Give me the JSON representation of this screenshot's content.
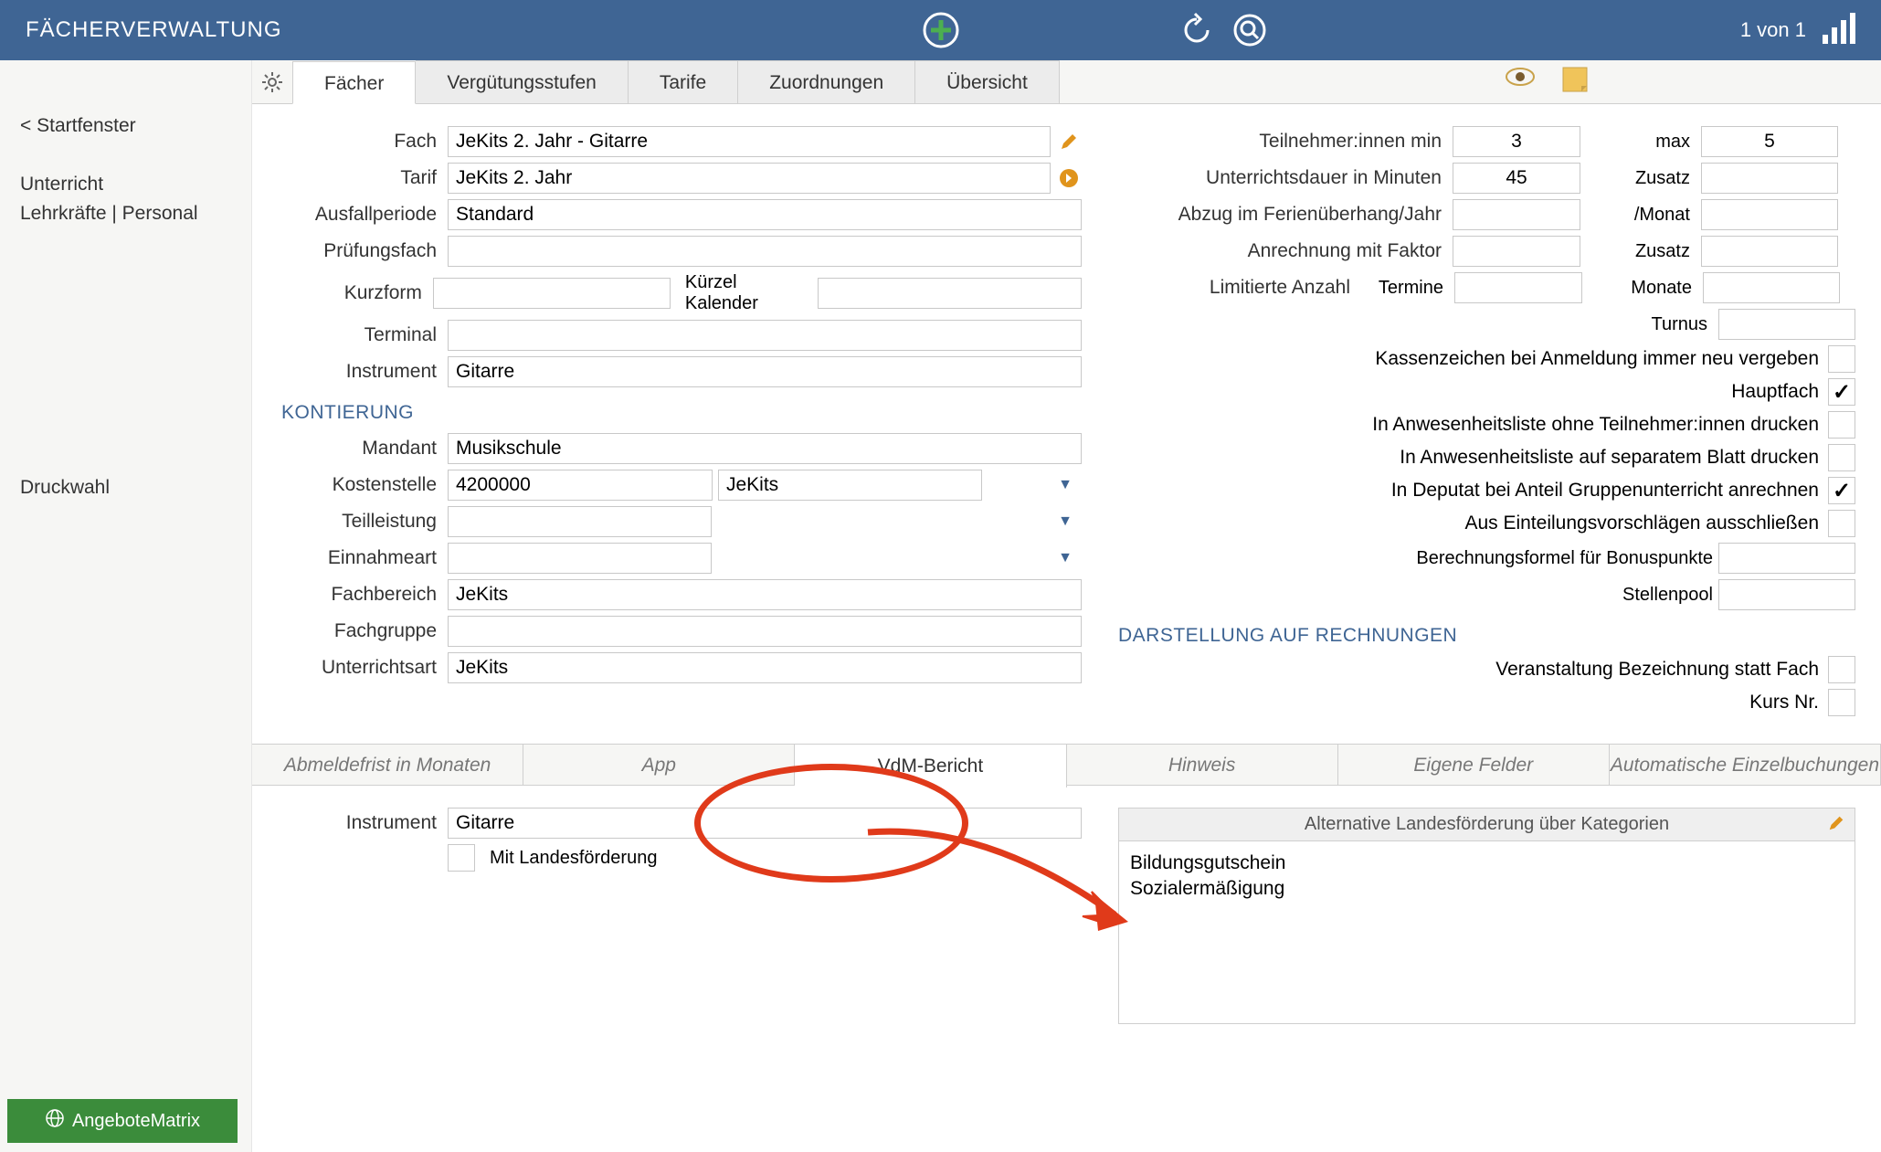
{
  "header": {
    "title": "FÄCHERVERWALTUNG",
    "counter": "1 von 1"
  },
  "sidebar": {
    "back": "< Startfenster",
    "unterricht": "Unterricht",
    "lehrkraefte": "Lehrkräfte | Personal",
    "druckwahl": "Druckwahl",
    "angebote": "AngeboteMatrix"
  },
  "tabs": {
    "t1": "Fächer",
    "t2": "Vergütungsstufen",
    "t3": "Tarife",
    "t4": "Zuordnungen",
    "t5": "Übersicht"
  },
  "left": {
    "fach_lbl": "Fach",
    "fach": "JeKits 2. Jahr - Gitarre",
    "tarif_lbl": "Tarif",
    "tarif": "JeKits 2. Jahr",
    "ausfall_lbl": "Ausfallperiode",
    "ausfall": "Standard",
    "pruef_lbl": "Prüfungsfach",
    "pruef": "",
    "kurz_lbl": "Kurzform",
    "kurz": "",
    "kuerzel_lbl": "Kürzel Kalender",
    "kuerzel": "",
    "terminal_lbl": "Terminal",
    "terminal": "",
    "instrument_lbl": "Instrument",
    "instrument": "Gitarre",
    "kontierung_title": "KONTIERUNG",
    "mandant_lbl": "Mandant",
    "mandant": "Musikschule",
    "kosten_lbl": "Kostenstelle",
    "kosten_num": "4200000",
    "kosten_name": "JeKits",
    "teill_lbl": "Teilleistung",
    "teill": "",
    "einnahme_lbl": "Einnahmeart",
    "einnahme": "",
    "fachbereich_lbl": "Fachbereich",
    "fachbereich": "JeKits",
    "fachgruppe_lbl": "Fachgruppe",
    "fachgruppe": "",
    "unterrichtsart_lbl": "Unterrichtsart",
    "unterrichtsart": "JeKits"
  },
  "right": {
    "teiln_lbl": "Teilnehmer:innen min",
    "teiln_min": "3",
    "max_lbl": "max",
    "teiln_max": "5",
    "dauer_lbl": "Unterrichtsdauer in Minuten",
    "dauer": "45",
    "zusatz_lbl": "Zusatz",
    "zusatz": "",
    "abzug_lbl": "Abzug im Ferienüberhang/Jahr",
    "abzug": "",
    "monat_lbl": "/Monat",
    "monat": "",
    "anrech_lbl": "Anrechnung mit Faktor",
    "anrech": "",
    "zusatz2_lbl": "Zusatz",
    "zusatz2": "",
    "limit_lbl": "Limitierte Anzahl",
    "termine_lbl": "Termine",
    "termine": "",
    "monate_lbl": "Monate",
    "monate": "",
    "turnus_lbl": "Turnus",
    "turnus": "",
    "cb1": "Kassenzeichen bei Anmeldung immer neu vergeben",
    "cb2": "Hauptfach",
    "cb3": "In Anwesenheitsliste ohne Teilnehmer:innen drucken",
    "cb4": "In Anwesenheitsliste auf separatem Blatt drucken",
    "cb5": "In Deputat bei Anteil Gruppenunterricht anrechnen",
    "cb6": "Aus Einteilungsvorschlägen ausschließen",
    "bonus_lbl": "Berechnungsformel für Bonuspunkte",
    "bonus": "",
    "pool_lbl": "Stellenpool",
    "pool": "",
    "darst_title": "DARSTELLUNG AUF RECHNUNGEN",
    "cb7": "Veranstaltung Bezeichnung statt Fach",
    "cb8": "Kurs Nr."
  },
  "subtabs": {
    "s1": "Abmeldefrist in Monaten",
    "s2": "App",
    "s3": "VdM-Bericht",
    "s4": "Hinweis",
    "s5": "Eigene Felder",
    "s6": "Automatische Einzelbuchungen"
  },
  "sub": {
    "instrument_lbl": "Instrument",
    "instrument": "Gitarre",
    "landes_lbl": "Mit Landesförderung",
    "panel_title": "Alternative Landesförderung über Kategorien",
    "item1": "Bildungsgutschein",
    "item2": "Sozialermäßigung"
  }
}
